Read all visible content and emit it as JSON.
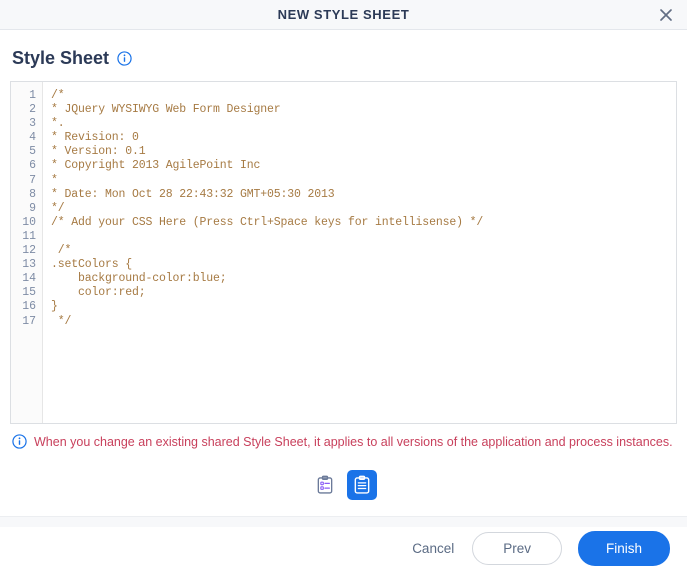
{
  "window": {
    "title": "NEW STYLE SHEET",
    "close_icon": "close-icon"
  },
  "section": {
    "title": "Style Sheet",
    "info_icon": "info-icon"
  },
  "editor": {
    "line_numbers": [
      "1",
      "2",
      "3",
      "4",
      "5",
      "6",
      "7",
      "8",
      "9",
      "10",
      "11",
      "12",
      "13",
      "14",
      "15",
      "16",
      "17"
    ],
    "lines": [
      "/*",
      "* JQuery WYSIWYG Web Form Designer",
      "*.",
      "* Revision: 0",
      "* Version: 0.1",
      "* Copyright 2013 AgilePoint Inc",
      "*",
      "* Date: Mon Oct 28 22:43:32 GMT+05:30 2013",
      "*/",
      "/* Add your CSS Here (Press Ctrl+Space keys for intellisense) */",
      "",
      " /*",
      ".setColors {",
      "    background-color:blue;",
      "    color:red;",
      "}",
      " */"
    ],
    "comment_color": "#a67a43"
  },
  "note": {
    "icon": "info-icon",
    "text": "When you change an existing shared Style Sheet, it applies to all versions of the application and process instances.",
    "text_color": "#c8405c"
  },
  "toggles": [
    {
      "name": "checklist-clipboard-icon",
      "label": "",
      "active": false
    },
    {
      "name": "lined-clipboard-icon",
      "label": "",
      "active": true
    }
  ],
  "footer": {
    "cancel_label": "Cancel",
    "prev_label": "Prev",
    "finish_label": "Finish",
    "accent_color": "#1a73e8"
  }
}
